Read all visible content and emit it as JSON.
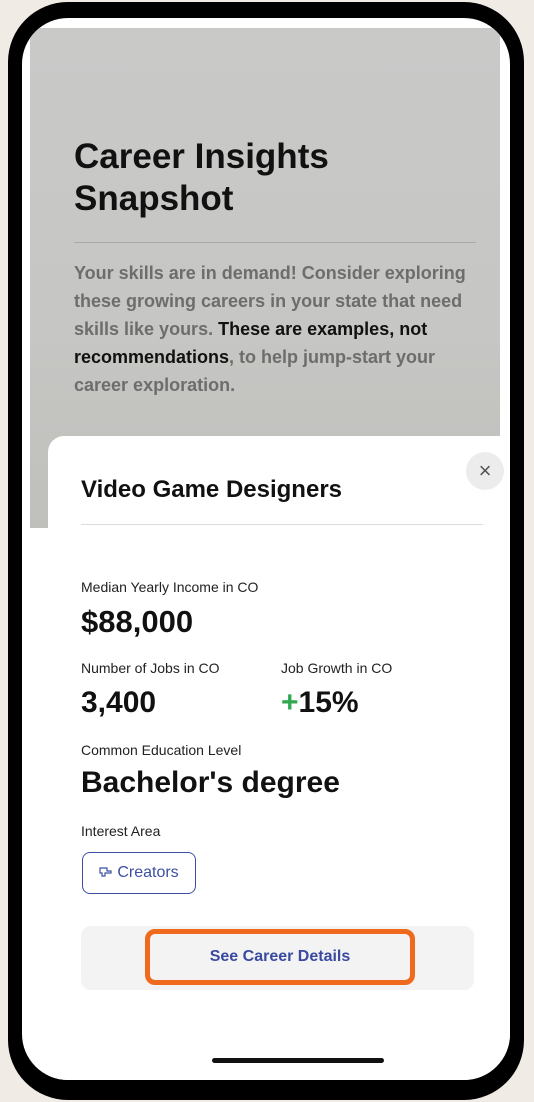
{
  "background": {
    "title": "Career Insights Snapshot",
    "desc_part1": "Your skills are in demand! Consider exploring these growing careers in your state that need skills like yours. ",
    "desc_strong": "These are examples, not recommendations",
    "desc_part2": ", to help jump-start your career exploration."
  },
  "sheet": {
    "close_symbol": "×",
    "title": "Video Game Designers",
    "income_label": "Median Yearly Income in CO",
    "income_value": "$88,000",
    "jobs_label": "Number of Jobs in CO",
    "jobs_value": "3,400",
    "growth_label": "Job Growth in CO",
    "growth_sign": "+",
    "growth_value": "15%",
    "education_label": "Common Education Level",
    "education_value": "Bachelor's degree",
    "interest_label": "Interest Area",
    "interest_chip_icon": "tools-icon",
    "interest_chip": "Creators",
    "details_button": "See Career Details"
  },
  "colors": {
    "accent_orange": "#f06a1d",
    "link_blue": "#3a4aa0",
    "growth_green": "#2fa84f"
  }
}
